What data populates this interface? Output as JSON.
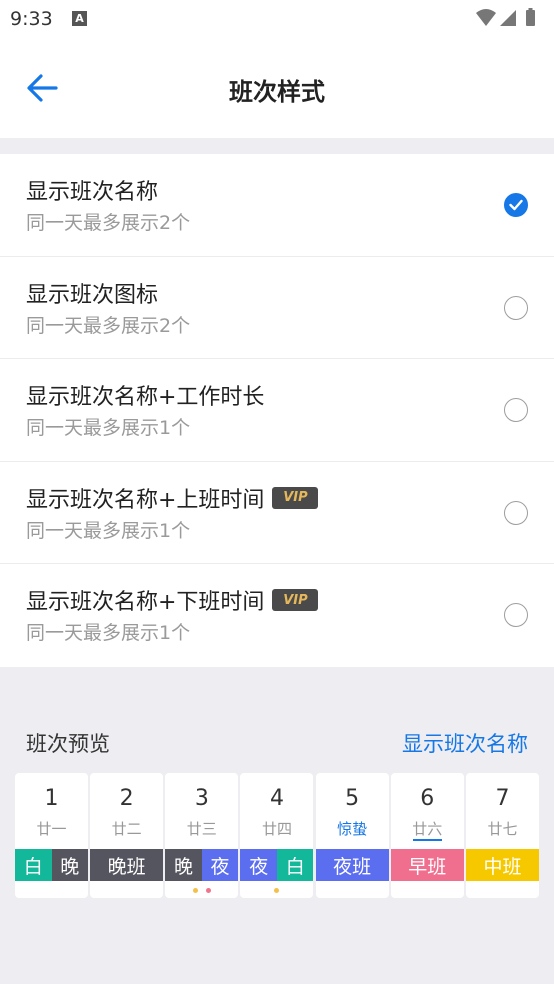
{
  "status_bar": {
    "time": "9:33",
    "notification_glyph": "A",
    "icons": [
      "wifi-icon",
      "cellular-signal-icon",
      "battery-icon"
    ]
  },
  "header": {
    "title": "班次样式",
    "back_icon": "arrow-left-icon"
  },
  "options": [
    {
      "title": "显示班次名称",
      "subtitle": "同一天最多展示2个",
      "selected": true,
      "vip": false
    },
    {
      "title": "显示班次图标",
      "subtitle": "同一天最多展示2个",
      "selected": false,
      "vip": false
    },
    {
      "title": "显示班次名称+工作时长",
      "subtitle": "同一天最多展示1个",
      "selected": false,
      "vip": false
    },
    {
      "title": "显示班次名称+上班时间",
      "subtitle": "同一天最多展示1个",
      "selected": false,
      "vip": true,
      "badge": "VIP"
    },
    {
      "title": "显示班次名称+下班时间",
      "subtitle": "同一天最多展示1个",
      "selected": false,
      "vip": true,
      "badge": "VIP"
    }
  ],
  "preview": {
    "heading": "班次预览",
    "mode_label": "显示班次名称",
    "days": [
      {
        "num": "1",
        "lunar": "廿一",
        "shifts": [
          {
            "label": "白",
            "color": "#13b89a"
          },
          {
            "label": "晚",
            "color": "#55555f"
          }
        ],
        "dots": []
      },
      {
        "num": "2",
        "lunar": "廿二",
        "shifts": [
          {
            "label": "晚班",
            "color": "#55555f"
          }
        ],
        "dots": []
      },
      {
        "num": "3",
        "lunar": "廿三",
        "shifts": [
          {
            "label": "晚",
            "color": "#55555f"
          },
          {
            "label": "夜",
            "color": "#5b6ef0"
          }
        ],
        "dots": [
          "#f5c04a",
          "#f0748a"
        ]
      },
      {
        "num": "4",
        "lunar": "廿四",
        "shifts": [
          {
            "label": "夜",
            "color": "#5b6ef0"
          },
          {
            "label": "白",
            "color": "#13b89a"
          }
        ],
        "dots": [
          "#f5c04a"
        ]
      },
      {
        "num": "5",
        "lunar": "惊蛰",
        "lunar_is_term": true,
        "shifts": [
          {
            "label": "夜班",
            "color": "#5b6ef0"
          }
        ],
        "dots": []
      },
      {
        "num": "6",
        "lunar": "廿六",
        "today": true,
        "shifts": [
          {
            "label": "早班",
            "color": "#f06e8e"
          }
        ],
        "dots": []
      },
      {
        "num": "7",
        "lunar": "廿七",
        "shifts": [
          {
            "label": "中班",
            "color": "#f5c800"
          }
        ],
        "dots": []
      }
    ]
  },
  "colors": {
    "accent": "#1677e6",
    "background": "#ededf2",
    "vip_gold": "#e6b85c"
  }
}
